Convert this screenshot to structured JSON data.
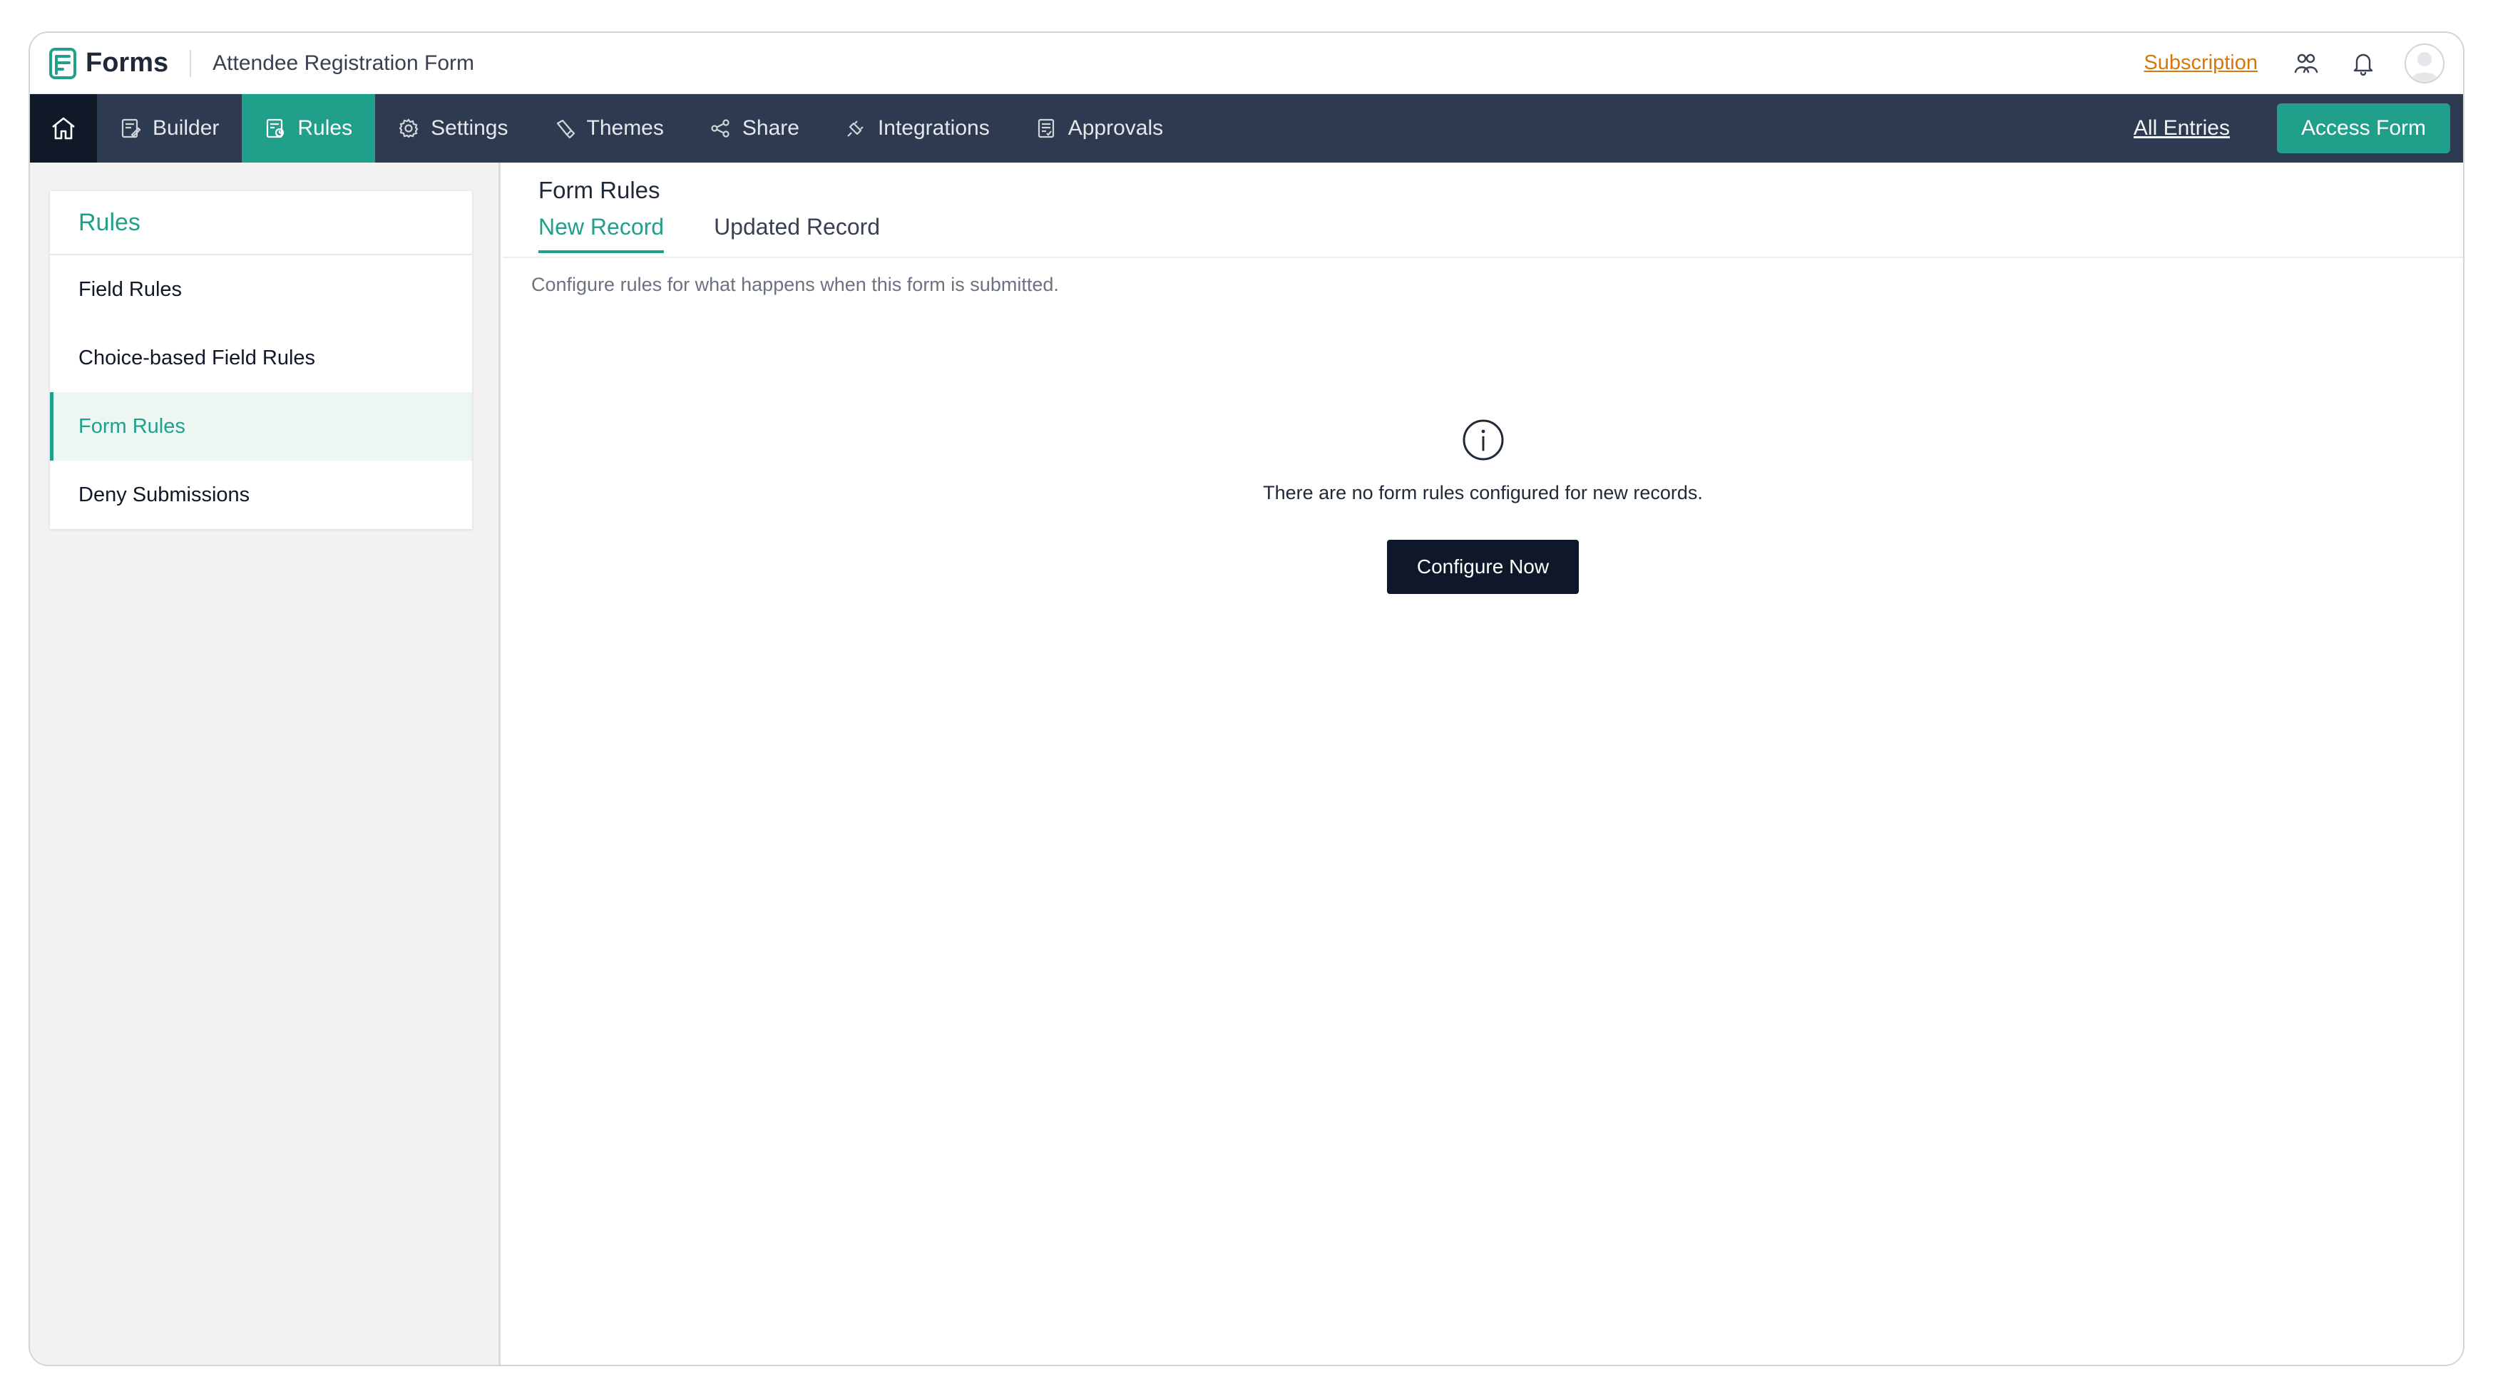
{
  "header": {
    "brand": "Forms",
    "form_title": "Attendee Registration Form",
    "subscription_label": "Subscription",
    "icons": [
      "forms-logo-icon",
      "team-icon",
      "bell-icon",
      "avatar-icon"
    ]
  },
  "nav": {
    "items": [
      {
        "label": "Builder",
        "icon": "builder-icon"
      },
      {
        "label": "Rules",
        "icon": "rules-icon"
      },
      {
        "label": "Settings",
        "icon": "gear-icon"
      },
      {
        "label": "Themes",
        "icon": "brush-icon"
      },
      {
        "label": "Share",
        "icon": "share-icon"
      },
      {
        "label": "Integrations",
        "icon": "plug-icon"
      },
      {
        "label": "Approvals",
        "icon": "approvals-icon"
      }
    ],
    "active": "Rules",
    "all_entries_label": "All Entries",
    "access_form_label": "Access Form"
  },
  "sidebar": {
    "title": "Rules",
    "items": [
      {
        "label": "Field Rules"
      },
      {
        "label": "Choice-based Field Rules"
      },
      {
        "label": "Form Rules"
      },
      {
        "label": "Deny Submissions"
      }
    ],
    "active": "Form Rules"
  },
  "main": {
    "title": "Form Rules",
    "tabs": [
      {
        "label": "New Record"
      },
      {
        "label": "Updated Record"
      }
    ],
    "active_tab": "New Record",
    "description": "Configure rules for what happens when this form is submitted.",
    "empty_message": "There are no form rules configured for new records.",
    "configure_label": "Configure Now"
  },
  "colors": {
    "accent": "#20a08a",
    "nav_bg": "#2e3a4f",
    "subscription": "#d97706",
    "button_dark": "#0f172a"
  }
}
